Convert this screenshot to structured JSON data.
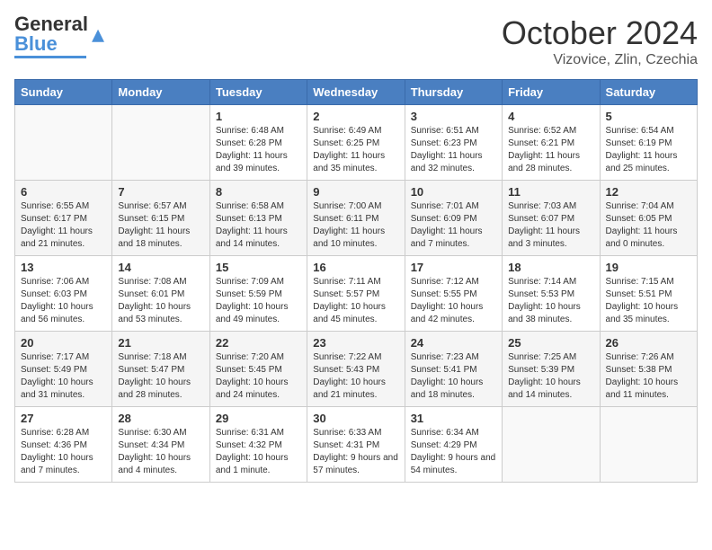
{
  "header": {
    "logo_line1": "General",
    "logo_line2": "Blue",
    "title": "October 2024",
    "subtitle": "Vizovice, Zlin, Czechia"
  },
  "days_of_week": [
    "Sunday",
    "Monday",
    "Tuesday",
    "Wednesday",
    "Thursday",
    "Friday",
    "Saturday"
  ],
  "weeks": [
    [
      {
        "day": "",
        "info": ""
      },
      {
        "day": "",
        "info": ""
      },
      {
        "day": "1",
        "info": "Sunrise: 6:48 AM\nSunset: 6:28 PM\nDaylight: 11 hours and 39 minutes."
      },
      {
        "day": "2",
        "info": "Sunrise: 6:49 AM\nSunset: 6:25 PM\nDaylight: 11 hours and 35 minutes."
      },
      {
        "day": "3",
        "info": "Sunrise: 6:51 AM\nSunset: 6:23 PM\nDaylight: 11 hours and 32 minutes."
      },
      {
        "day": "4",
        "info": "Sunrise: 6:52 AM\nSunset: 6:21 PM\nDaylight: 11 hours and 28 minutes."
      },
      {
        "day": "5",
        "info": "Sunrise: 6:54 AM\nSunset: 6:19 PM\nDaylight: 11 hours and 25 minutes."
      }
    ],
    [
      {
        "day": "6",
        "info": "Sunrise: 6:55 AM\nSunset: 6:17 PM\nDaylight: 11 hours and 21 minutes."
      },
      {
        "day": "7",
        "info": "Sunrise: 6:57 AM\nSunset: 6:15 PM\nDaylight: 11 hours and 18 minutes."
      },
      {
        "day": "8",
        "info": "Sunrise: 6:58 AM\nSunset: 6:13 PM\nDaylight: 11 hours and 14 minutes."
      },
      {
        "day": "9",
        "info": "Sunrise: 7:00 AM\nSunset: 6:11 PM\nDaylight: 11 hours and 10 minutes."
      },
      {
        "day": "10",
        "info": "Sunrise: 7:01 AM\nSunset: 6:09 PM\nDaylight: 11 hours and 7 minutes."
      },
      {
        "day": "11",
        "info": "Sunrise: 7:03 AM\nSunset: 6:07 PM\nDaylight: 11 hours and 3 minutes."
      },
      {
        "day": "12",
        "info": "Sunrise: 7:04 AM\nSunset: 6:05 PM\nDaylight: 11 hours and 0 minutes."
      }
    ],
    [
      {
        "day": "13",
        "info": "Sunrise: 7:06 AM\nSunset: 6:03 PM\nDaylight: 10 hours and 56 minutes."
      },
      {
        "day": "14",
        "info": "Sunrise: 7:08 AM\nSunset: 6:01 PM\nDaylight: 10 hours and 53 minutes."
      },
      {
        "day": "15",
        "info": "Sunrise: 7:09 AM\nSunset: 5:59 PM\nDaylight: 10 hours and 49 minutes."
      },
      {
        "day": "16",
        "info": "Sunrise: 7:11 AM\nSunset: 5:57 PM\nDaylight: 10 hours and 45 minutes."
      },
      {
        "day": "17",
        "info": "Sunrise: 7:12 AM\nSunset: 5:55 PM\nDaylight: 10 hours and 42 minutes."
      },
      {
        "day": "18",
        "info": "Sunrise: 7:14 AM\nSunset: 5:53 PM\nDaylight: 10 hours and 38 minutes."
      },
      {
        "day": "19",
        "info": "Sunrise: 7:15 AM\nSunset: 5:51 PM\nDaylight: 10 hours and 35 minutes."
      }
    ],
    [
      {
        "day": "20",
        "info": "Sunrise: 7:17 AM\nSunset: 5:49 PM\nDaylight: 10 hours and 31 minutes."
      },
      {
        "day": "21",
        "info": "Sunrise: 7:18 AM\nSunset: 5:47 PM\nDaylight: 10 hours and 28 minutes."
      },
      {
        "day": "22",
        "info": "Sunrise: 7:20 AM\nSunset: 5:45 PM\nDaylight: 10 hours and 24 minutes."
      },
      {
        "day": "23",
        "info": "Sunrise: 7:22 AM\nSunset: 5:43 PM\nDaylight: 10 hours and 21 minutes."
      },
      {
        "day": "24",
        "info": "Sunrise: 7:23 AM\nSunset: 5:41 PM\nDaylight: 10 hours and 18 minutes."
      },
      {
        "day": "25",
        "info": "Sunrise: 7:25 AM\nSunset: 5:39 PM\nDaylight: 10 hours and 14 minutes."
      },
      {
        "day": "26",
        "info": "Sunrise: 7:26 AM\nSunset: 5:38 PM\nDaylight: 10 hours and 11 minutes."
      }
    ],
    [
      {
        "day": "27",
        "info": "Sunrise: 6:28 AM\nSunset: 4:36 PM\nDaylight: 10 hours and 7 minutes."
      },
      {
        "day": "28",
        "info": "Sunrise: 6:30 AM\nSunset: 4:34 PM\nDaylight: 10 hours and 4 minutes."
      },
      {
        "day": "29",
        "info": "Sunrise: 6:31 AM\nSunset: 4:32 PM\nDaylight: 10 hours and 1 minute."
      },
      {
        "day": "30",
        "info": "Sunrise: 6:33 AM\nSunset: 4:31 PM\nDaylight: 9 hours and 57 minutes."
      },
      {
        "day": "31",
        "info": "Sunrise: 6:34 AM\nSunset: 4:29 PM\nDaylight: 9 hours and 54 minutes."
      },
      {
        "day": "",
        "info": ""
      },
      {
        "day": "",
        "info": ""
      }
    ]
  ]
}
